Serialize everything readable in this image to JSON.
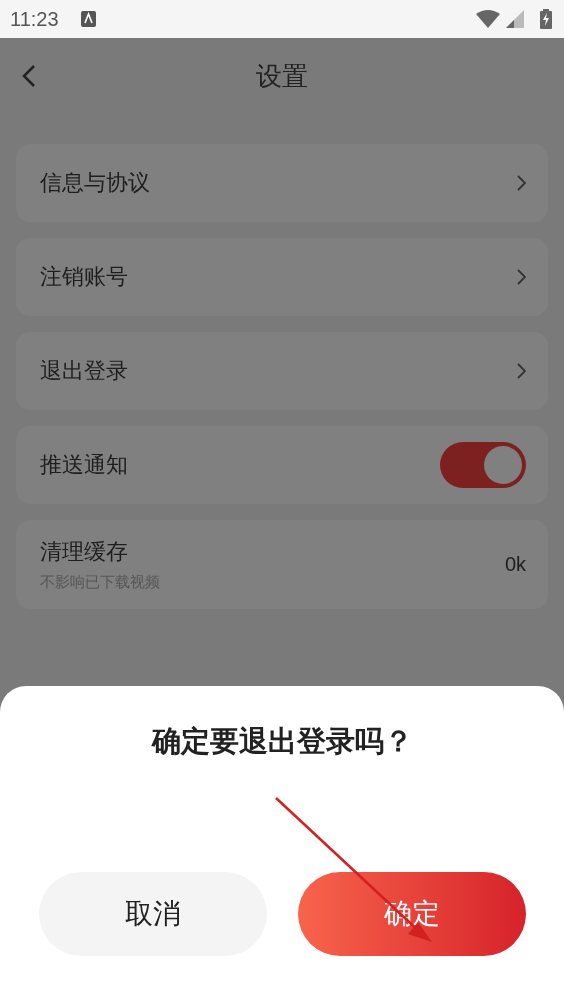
{
  "status_bar": {
    "time": "11:23"
  },
  "header": {
    "title": "设置"
  },
  "settings": [
    {
      "kind": "link",
      "label": "信息与协议"
    },
    {
      "kind": "link",
      "label": "注销账号"
    },
    {
      "kind": "link",
      "label": "退出登录"
    },
    {
      "kind": "toggle",
      "label": "推送通知",
      "on": true
    },
    {
      "kind": "value",
      "label": "清理缓存",
      "description": "不影响已下载视频",
      "value": "0k"
    }
  ],
  "dialog": {
    "title": "确定要退出登录吗？",
    "buttons": [
      {
        "label": "取消",
        "kind": "secondary"
      },
      {
        "label": "确定",
        "kind": "primary"
      }
    ]
  }
}
